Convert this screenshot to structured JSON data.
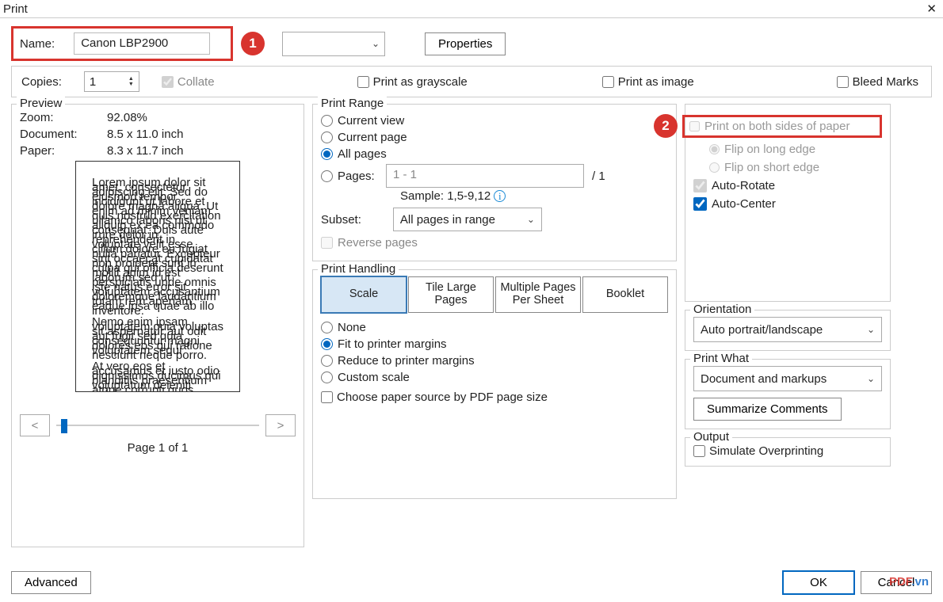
{
  "title": "Print",
  "name_label": "Name:",
  "printer_name": "Canon LBP2900",
  "properties_btn": "Properties",
  "copies_label": "Copies:",
  "copies_value": "1",
  "collate": "Collate",
  "grayscale": "Print as grayscale",
  "as_image": "Print as image",
  "bleed": "Bleed Marks",
  "preview": {
    "legend": "Preview",
    "zoom_k": "Zoom:",
    "zoom_v": "92.08%",
    "doc_k": "Document:",
    "doc_v": "8.5 x 11.0 inch",
    "paper_k": "Paper:",
    "paper_v": "8.3 x 11.7 inch",
    "prev": "<",
    "next": ">",
    "page_of": "Page 1 of 1"
  },
  "range": {
    "legend": "Print Range",
    "current_view": "Current view",
    "current_page": "Current page",
    "all_pages": "All pages",
    "pages": "Pages:",
    "pages_value": "1 - 1",
    "total": "/ 1",
    "sample": "Sample: 1,5-9,12",
    "subset": "Subset:",
    "subset_value": "All pages in range",
    "reverse": "Reverse pages"
  },
  "handling": {
    "legend": "Print Handling",
    "tabs": {
      "scale": "Scale",
      "tile": "Tile Large Pages",
      "multi": "Multiple Pages Per Sheet",
      "booklet": "Booklet"
    },
    "none": "None",
    "fit": "Fit to printer margins",
    "reduce": "Reduce to printer margins",
    "custom": "Custom scale",
    "paper_source": "Choose paper source by PDF page size"
  },
  "duplex": {
    "both_sides": "Print on both sides of paper",
    "long_edge": "Flip on long edge",
    "short_edge": "Flip on short edge",
    "auto_rotate": "Auto-Rotate",
    "auto_center": "Auto-Center"
  },
  "orientation": {
    "legend": "Orientation",
    "value": "Auto portrait/landscape"
  },
  "print_what": {
    "legend": "Print What",
    "value": "Document and markups",
    "summarize": "Summarize Comments"
  },
  "output": {
    "legend": "Output",
    "simulate": "Simulate Overprinting"
  },
  "footer": {
    "advanced": "Advanced",
    "ok": "OK",
    "cancel": "Cancel"
  },
  "badges": {
    "one": "1",
    "two": "2"
  },
  "watermark": {
    "pdf": "PDF",
    "vn": ".vn"
  }
}
